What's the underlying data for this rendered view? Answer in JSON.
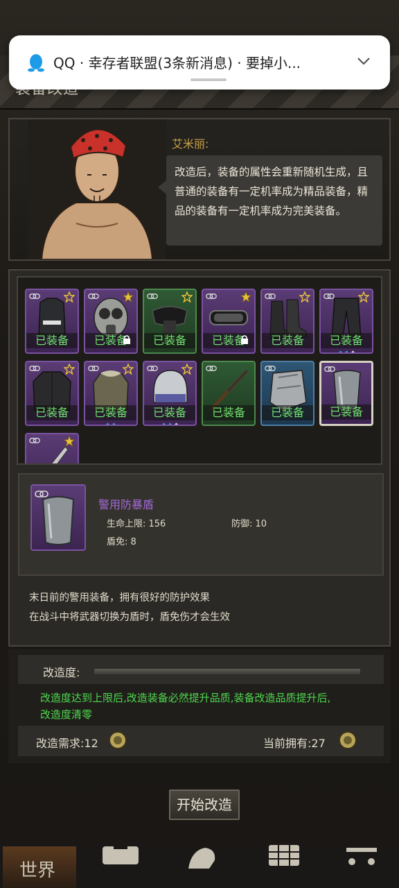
{
  "notification": {
    "app": "QQ",
    "text": "QQ · 幸存者联盟(3条新消息) · 要掉小...",
    "icon": "qq-penguin-icon",
    "chevron": "chevron-down-icon"
  },
  "window": {
    "title": "装备改造",
    "close_icon": "close-icon"
  },
  "npc": {
    "name": "艾米丽:",
    "speech_lines": [
      "改造后，装备的属性会重新随机生成，且",
      "普通的装备有一定机率成为精品装备，精",
      "品的装备有一定机率成为完美装备。"
    ]
  },
  "inventory": {
    "items": [
      {
        "name": "police-vest",
        "rarity": "purple",
        "star": "outline",
        "label": "已装备",
        "lock": false,
        "gems": []
      },
      {
        "name": "gas-mask",
        "rarity": "purple",
        "star": "gold",
        "label": "已装备",
        "lock": true,
        "gems": []
      },
      {
        "name": "tactical-goggles",
        "rarity": "green",
        "star": "outline",
        "label": "已装备",
        "lock": false,
        "gems": []
      },
      {
        "name": "ski-goggles",
        "rarity": "purple",
        "star": "gold",
        "label": "已装备",
        "lock": true,
        "gems": []
      },
      {
        "name": "combat-boots",
        "rarity": "purple",
        "star": "outline",
        "label": "已装备",
        "lock": false,
        "gems": []
      },
      {
        "name": "cargo-pants",
        "rarity": "purple",
        "star": "outline",
        "label": "已装备",
        "lock": false,
        "gems": [
          "b",
          "b",
          "w"
        ]
      },
      {
        "name": "leather-jacket",
        "rarity": "purple",
        "star": "outline",
        "label": "已装备",
        "lock": false,
        "gems": []
      },
      {
        "name": "fur-parka",
        "rarity": "purple",
        "star": "outline",
        "label": "已装备",
        "lock": false,
        "gems": [
          "b",
          "b"
        ]
      },
      {
        "name": "riot-helmet",
        "rarity": "purple",
        "star": "outline",
        "label": "已装备",
        "lock": false,
        "gems": [
          "b",
          "b",
          "w"
        ]
      },
      {
        "name": "hunting-rifle",
        "rarity": "green",
        "star": "none",
        "label": "已装备",
        "lock": false,
        "gems": []
      },
      {
        "name": "metal-shield",
        "rarity": "blue",
        "star": "none",
        "label": "已装备",
        "lock": false,
        "gems": []
      },
      {
        "name": "riot-shield",
        "rarity": "purple",
        "star": "none",
        "label": "已装备",
        "lock": false,
        "gems": [],
        "selected": true
      },
      {
        "name": "knife",
        "rarity": "purple",
        "star": "gold",
        "label": "",
        "lock": false,
        "gems": []
      }
    ]
  },
  "detail": {
    "name": "警用防暴盾",
    "stats": {
      "hp": "生命上限: 156",
      "defense": "防御: 10",
      "shield": "盾免: 8"
    },
    "description": [
      "末日前的警用装备，拥有很好的防护效果",
      "在战斗中将武器切换为盾时，盾免伤才会生效"
    ]
  },
  "refinement": {
    "progress_label": "改造度:",
    "progress": 0.0,
    "note": "改造度达到上限后,改造装备必然提升品质,装备改造品质提升后,改造度清零",
    "requirement": "改造需求:12",
    "owned": "当前拥有:27",
    "coin_icon": "gear-coin-icon",
    "start_button": "开始改造"
  },
  "bottom_nav": {
    "world_label": "世界",
    "icons": [
      "backpack-icon",
      "profile-icon",
      "grid-icon",
      "cart-icon"
    ]
  },
  "colors": {
    "purple_rarity": "#7a52a0",
    "green_rarity": "#4d8a4d",
    "blue_rarity": "#4e7ea6",
    "equipped_text": "#6ee06e",
    "note_text": "#4ed84e",
    "npc_name": "#c8a046",
    "item_name": "#a46ad8"
  }
}
